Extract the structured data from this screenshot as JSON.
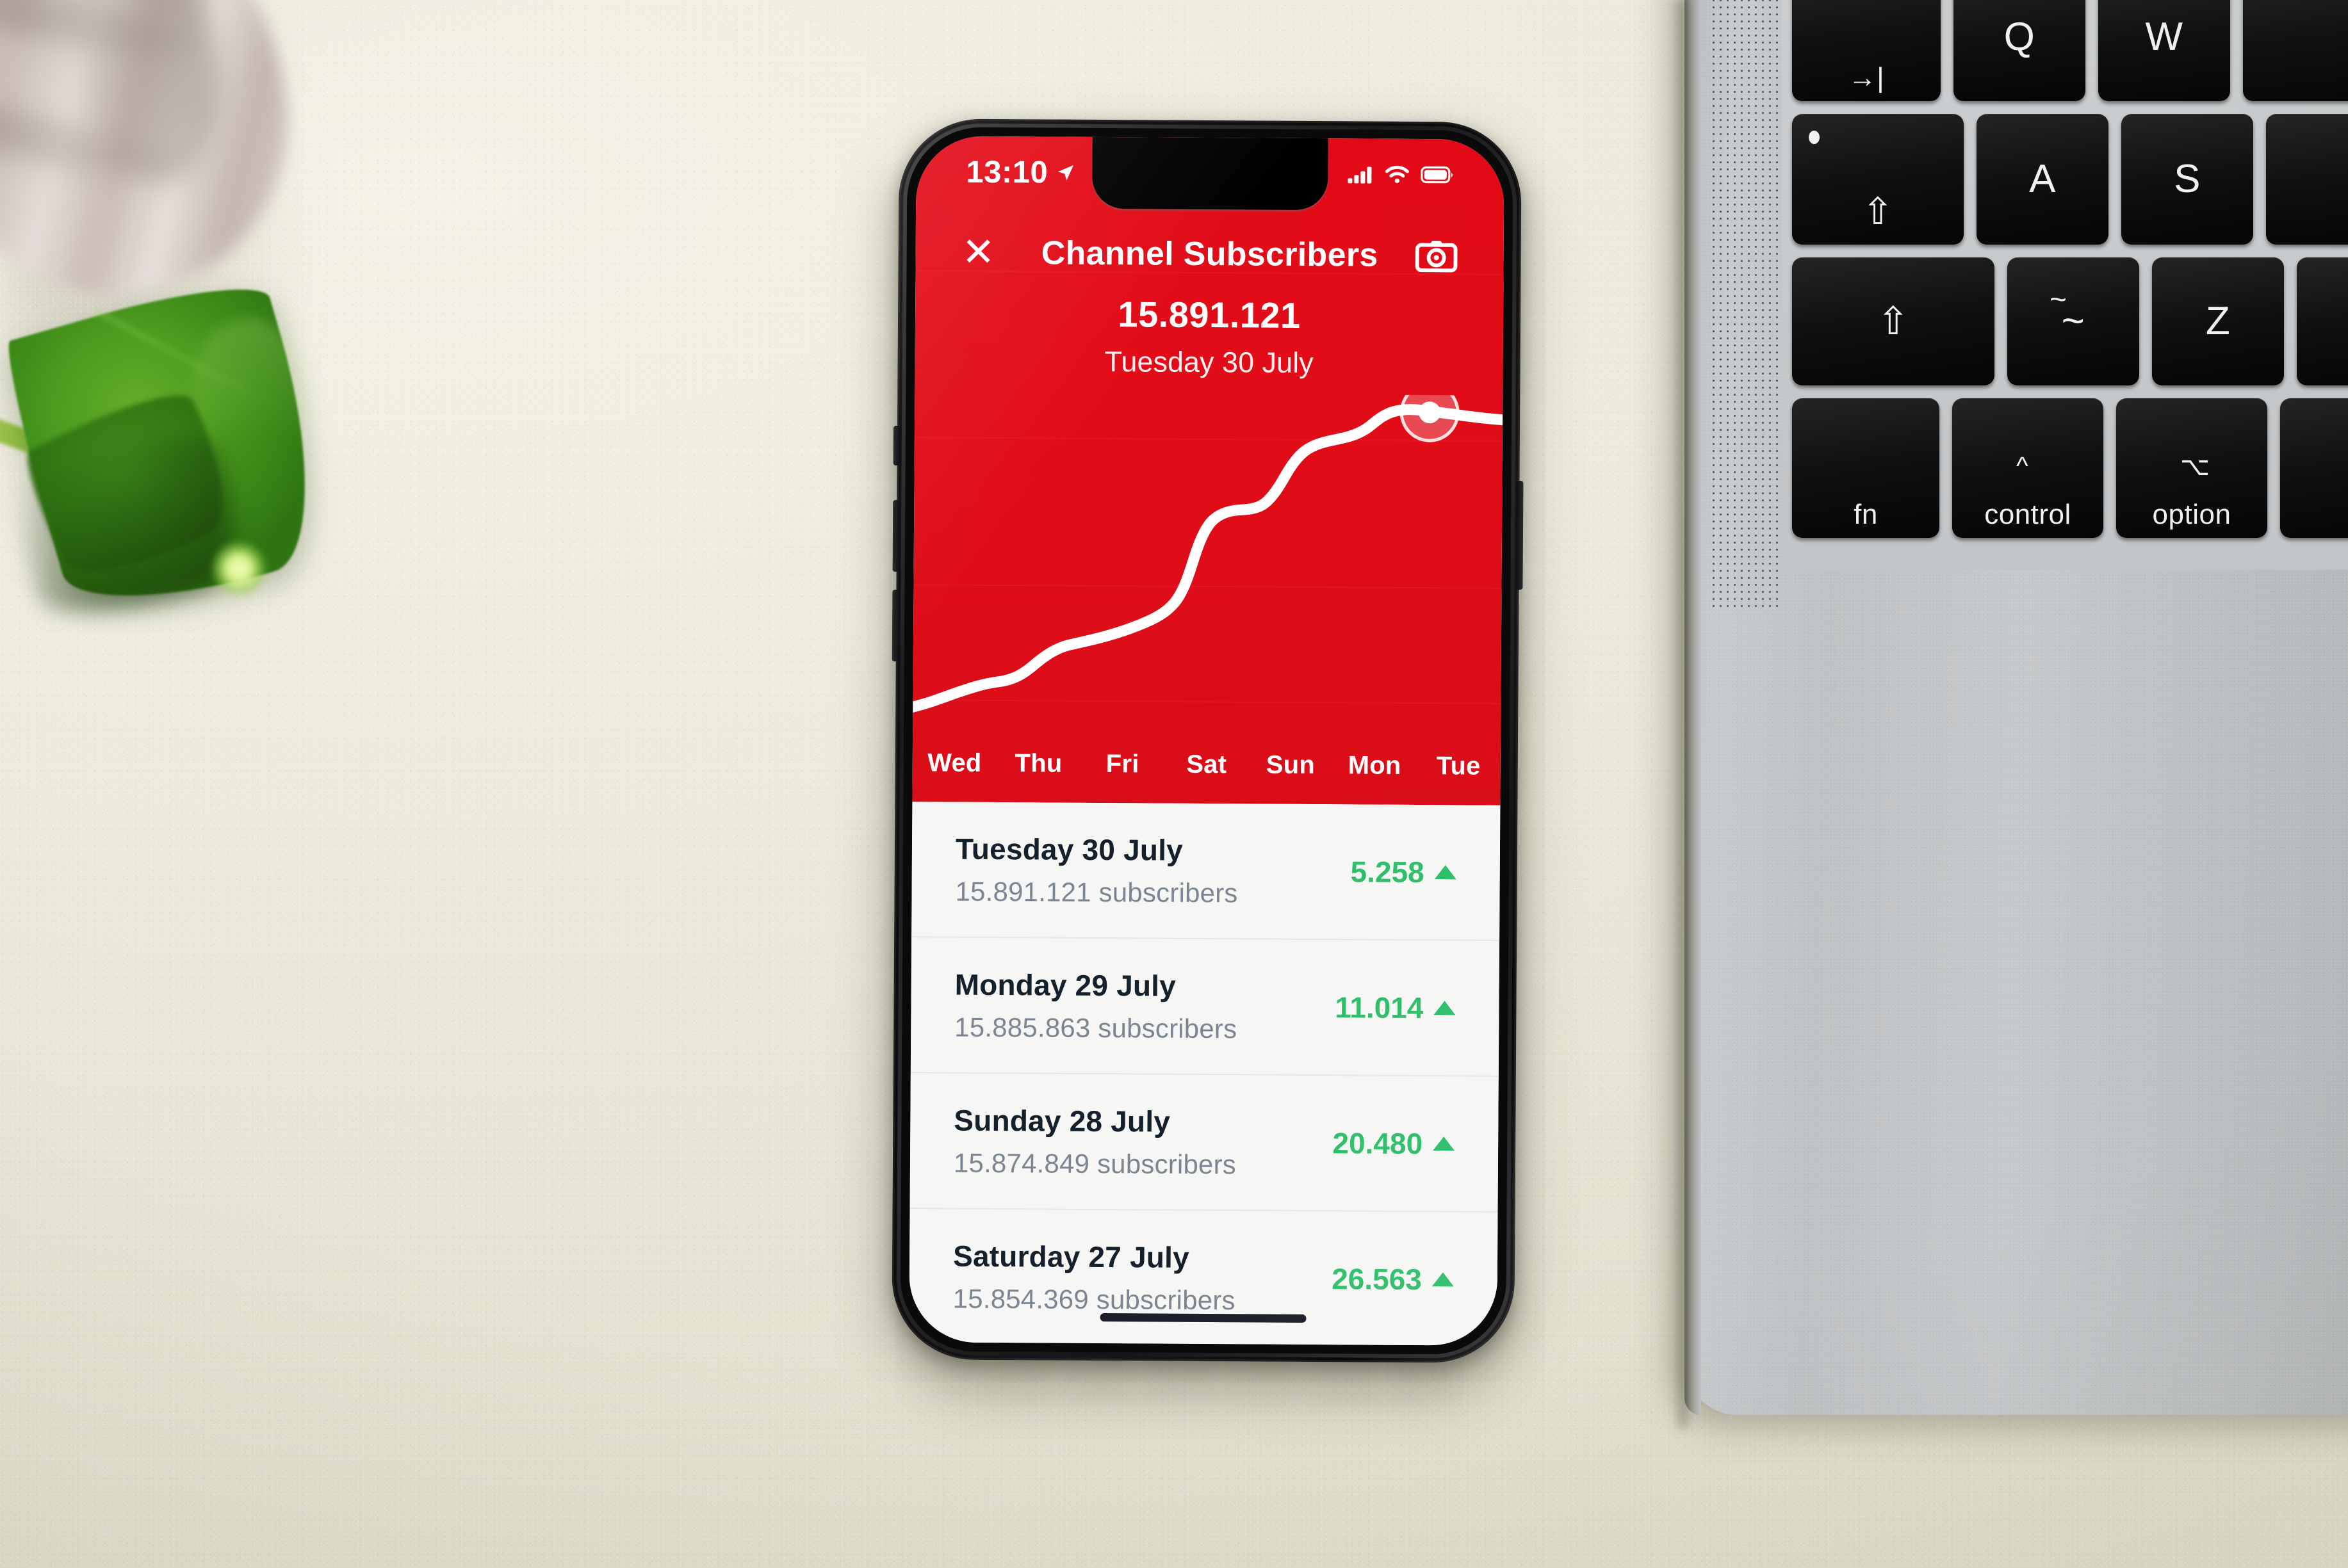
{
  "scene": {
    "objects": [
      "planter-stone",
      "plant-leaf",
      "smartphone",
      "laptop"
    ],
    "background_color": "#edeadd",
    "desk_surface": "cream painted desk"
  },
  "phone": {
    "status_bar": {
      "time": "13:10",
      "location_icon": "location-arrow-icon",
      "cellular_icon": "signal-bars-icon",
      "wifi_icon": "wifi-icon",
      "battery_icon": "battery-full-icon"
    },
    "nav": {
      "close_label": "✕",
      "title": "Channel Subscribers",
      "camera_icon": "camera-icon"
    },
    "summary": {
      "value": "15.891.121",
      "date": "Tuesday 30 July"
    },
    "axis_labels": [
      "Wed",
      "Thu",
      "Fri",
      "Sat",
      "Sun",
      "Mon",
      "Tue"
    ],
    "rows": [
      {
        "title": "Tuesday 30 July",
        "subtitle": "15.891.121 subscribers",
        "delta": "5.258",
        "direction": "up"
      },
      {
        "title": "Monday 29 July",
        "subtitle": "15.885.863 subscribers",
        "delta": "11.014",
        "direction": "up"
      },
      {
        "title": "Sunday 28 July",
        "subtitle": "15.874.849 subscribers",
        "delta": "20.480",
        "direction": "up"
      },
      {
        "title": "Saturday 27 July",
        "subtitle": "15.854.369 subscribers",
        "delta": "26.563",
        "direction": "up"
      }
    ],
    "colors": {
      "brand_red": "#e30a17",
      "list_background": "#f6f6f4",
      "positive_green": "#2fbf6b",
      "title_text": "#14202b",
      "subtitle_text": "#7b8692"
    }
  },
  "chart_data": {
    "type": "line",
    "title": "Channel Subscribers",
    "xlabel": "",
    "ylabel": "Subscribers",
    "categories": [
      "Wed",
      "Thu",
      "Fri",
      "Sat",
      "Sun",
      "Mon",
      "Tue"
    ],
    "x": [
      0,
      1,
      2,
      3,
      4,
      5,
      6
    ],
    "series": [
      {
        "name": "Subscribers",
        "values": [
          15760000,
          15790000,
          15812000,
          15854369,
          15874849,
          15885863,
          15891121
        ],
        "color": "#ffffff"
      }
    ],
    "ylim": [
      15750000,
      15895000
    ],
    "grid": false,
    "legend": "none",
    "marker": {
      "x": "Tue",
      "value": 15891121,
      "label": "15.891.121",
      "style": "ring-with-dot"
    },
    "daily_gains": [
      {
        "day": "Saturday 27 July",
        "gain": 26563
      },
      {
        "day": "Sunday 28 July",
        "gain": 20480
      },
      {
        "day": "Monday 29 July",
        "gain": 11014
      },
      {
        "day": "Tuesday 30 July",
        "gain": 5258
      }
    ]
  },
  "laptop": {
    "keys": [
      {
        "label": "→|",
        "name": "tab-key"
      },
      {
        "label": "Q",
        "name": "q-key"
      },
      {
        "label": "W",
        "name": "w-key"
      },
      {
        "label": "",
        "name": "caps-lock-key"
      },
      {
        "label": "A",
        "name": "a-key"
      },
      {
        "label": "S",
        "name": "s-key"
      },
      {
        "label": "⇧",
        "name": "shift-key"
      },
      {
        "label": "~",
        "name": "tilde-key"
      },
      {
        "label": "Z",
        "name": "z-key"
      },
      {
        "label": "fn",
        "name": "fn-key"
      },
      {
        "label": "control",
        "name": "control-key"
      },
      {
        "label": "option",
        "name": "option-key"
      }
    ],
    "body_color": "#c2c5c7",
    "speaker_grille": "perforated-speaker-grille"
  }
}
